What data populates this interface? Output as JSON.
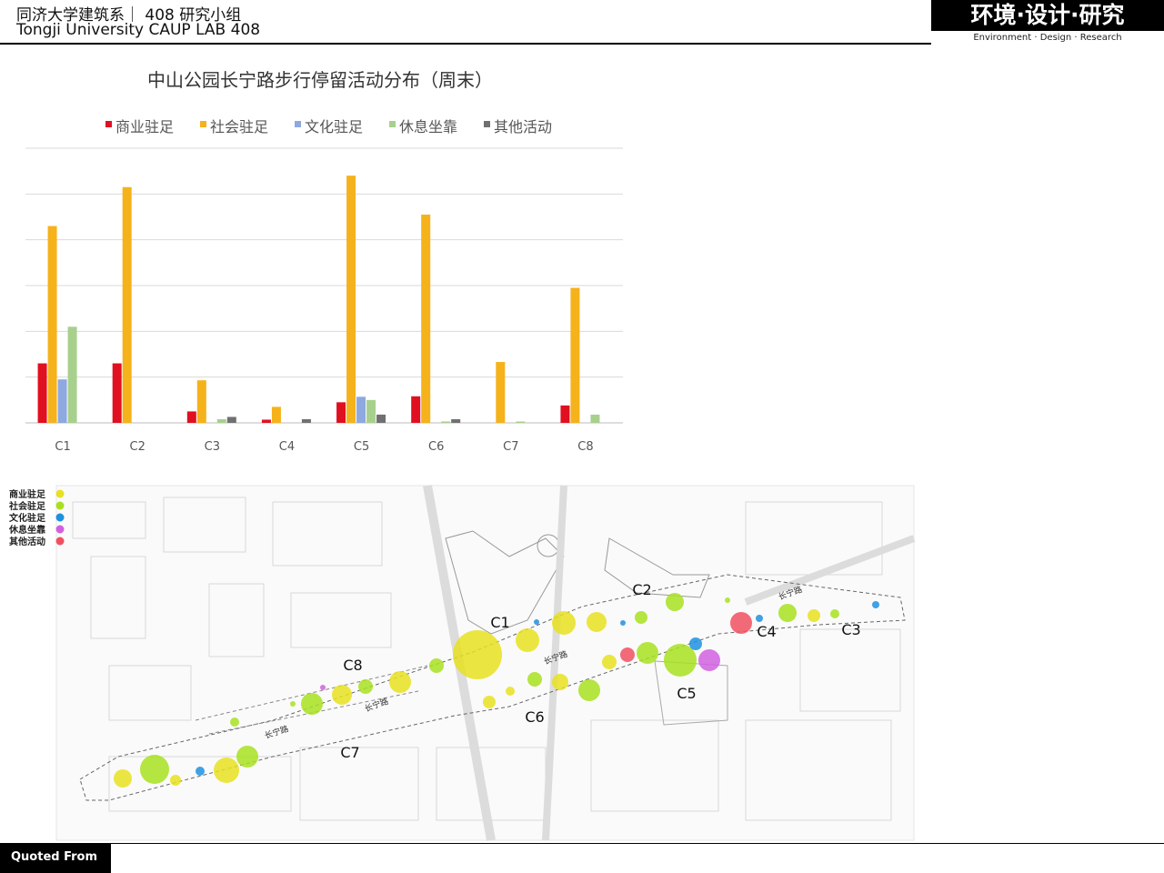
{
  "header": {
    "title_cn": "同济大学建筑系｜ 408 研究小组",
    "title_en": "Tongji University CAUP  LAB 408",
    "brand_cn": "环境·设计·研究",
    "brand_en": "Environment · Design · Research"
  },
  "chart_data": {
    "type": "bar",
    "title": "中山公园长宁路步行停留活动分布（周末）",
    "categories": [
      "C1",
      "C2",
      "C3",
      "C4",
      "C5",
      "C6",
      "C7",
      "C8"
    ],
    "series": [
      {
        "name": "商业驻足",
        "color": "#e01020",
        "values": [
          1.3,
          1.3,
          0.25,
          0.07,
          0.45,
          0.58,
          0,
          0.38
        ]
      },
      {
        "name": "社会驻足",
        "color": "#f5b21b",
        "values": [
          4.3,
          5.15,
          0.93,
          0.35,
          5.4,
          4.55,
          1.33,
          2.95
        ]
      },
      {
        "name": "文化驻足",
        "color": "#8ea8e0",
        "values": [
          0.95,
          0,
          0,
          0,
          0.57,
          0,
          0,
          0
        ]
      },
      {
        "name": "休息坐靠",
        "color": "#a8d08d",
        "values": [
          2.1,
          0,
          0.08,
          0,
          0.5,
          0.03,
          0.03,
          0.18
        ]
      },
      {
        "name": "其他活动",
        "color": "#707070",
        "values": [
          0,
          0,
          0.13,
          0.08,
          0.18,
          0.08,
          0,
          0
        ]
      }
    ],
    "ylim": [
      0,
      6
    ],
    "grid": true,
    "legend_position": "top"
  },
  "map": {
    "legend": [
      {
        "label": "商业驻足",
        "color": "#e8e020"
      },
      {
        "label": "社会驻足",
        "color": "#a8e020"
      },
      {
        "label": "文化驻足",
        "color": "#1e90e0"
      },
      {
        "label": "休息坐靠",
        "color": "#d060e0"
      },
      {
        "label": "其他活动",
        "color": "#f05060"
      }
    ],
    "zones": [
      "C1",
      "C2",
      "C3",
      "C4",
      "C5",
      "C6",
      "C7",
      "C8"
    ],
    "road_labels": [
      "长宁路",
      "长宁路",
      "长宁路",
      "长宁路"
    ]
  },
  "footer": {
    "text": "Quoted From"
  }
}
